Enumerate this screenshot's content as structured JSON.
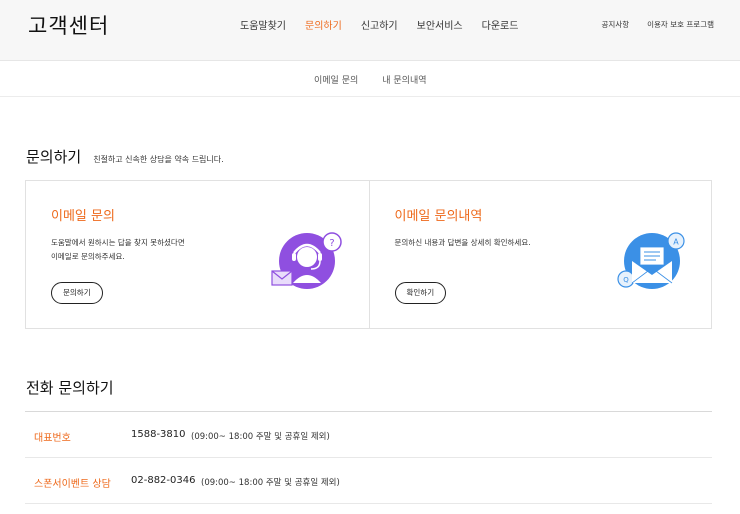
{
  "header": {
    "logo": "고객센터",
    "nav": [
      "도움말찾기",
      "문의하기",
      "신고하기",
      "보안서비스",
      "다운로드"
    ],
    "active_nav": 1,
    "util": [
      "공지사항",
      "이용자 보호 프로그램"
    ]
  },
  "subnav": {
    "tabs": [
      "이메일 문의",
      "내 문의내역"
    ]
  },
  "inquiry": {
    "title": "문의하기",
    "desc": "친절하고 신속한 상담을 약속 드립니다.",
    "cards": [
      {
        "title": "이메일 문의",
        "desc_line1": "도움말에서 원하시는 답을 찾지 못하셨다면",
        "desc_line2": "이메일로 문의하주세요.",
        "button": "문의하기",
        "icon": "headset-agent-icon"
      },
      {
        "title": "이메일 문의내역",
        "desc_line1": "문의하신 내용과 답변을 상세히 확인하세요.",
        "button": "확인하기",
        "icon": "mail-envelope-icon"
      }
    ]
  },
  "phone": {
    "title": "전화 문의하기",
    "rows": [
      {
        "label": "대표번호",
        "number": "1588-3810",
        "hours": "(09:00~ 18:00 주말 및 공휴일 제외)"
      },
      {
        "label": "스폰서이벤트 상담",
        "number": "02-882-0346",
        "hours": "(09:00~ 18:00 주말 및 공휴일 제외)"
      }
    ]
  },
  "colors": {
    "accent": "#ee6a1c",
    "purple": "#8f4fe0",
    "blue": "#3b90e6"
  }
}
